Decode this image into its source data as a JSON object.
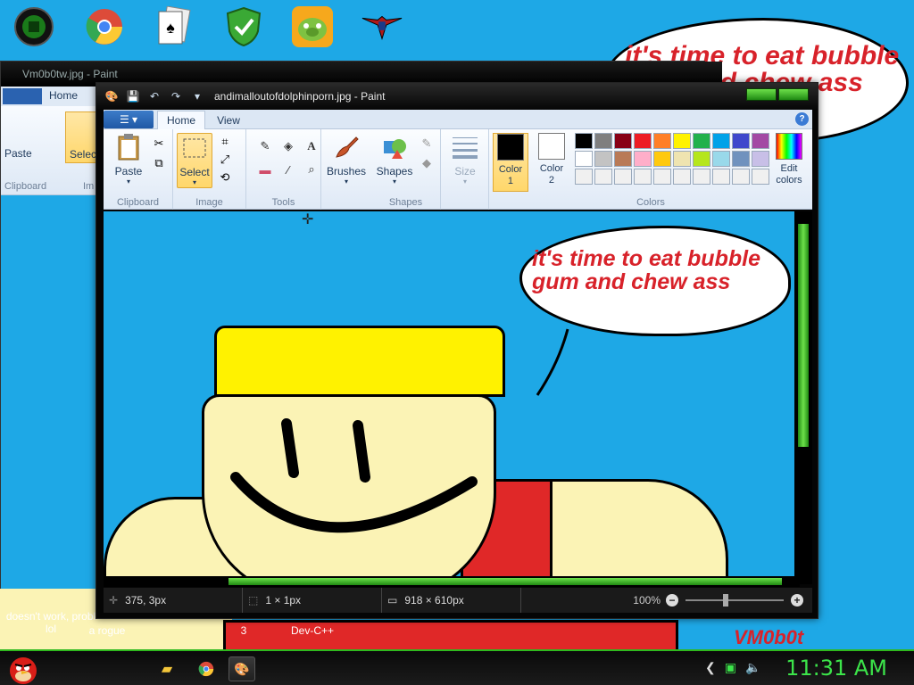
{
  "desktop": {
    "icons": [
      {
        "name": "desktop-app-icon-1",
        "icon": "green-circle-icon"
      },
      {
        "name": "chrome-icon",
        "icon": "chrome-icon"
      },
      {
        "name": "solitaire-icon",
        "icon": "cards-icon"
      },
      {
        "name": "security-shield-icon",
        "icon": "shield-icon"
      },
      {
        "name": "angry-birds-pig-icon",
        "icon": "pig-icon"
      },
      {
        "name": "emblem-icon",
        "icon": "winged-emblem-icon"
      }
    ],
    "labels": {
      "doesnt_work": "doesn't work, probl",
      "lol": "lol",
      "rogue": "a rogue",
      "three": "3",
      "devcpp": "Dev-C++"
    },
    "bubble_text": "it's time to eat bubble gum and chew ass",
    "watermark": "VM0b0t"
  },
  "back_window": {
    "title": "Vm0b0tw.jpg - Paint",
    "tab_home": "Home",
    "paste": "Paste",
    "select": "Selec",
    "clipboard": "Clipboard",
    "image": "Im"
  },
  "window": {
    "title": "andimalloutofdolphinporn.jpg - Paint",
    "tabs": {
      "home": "Home",
      "view": "View"
    },
    "ribbon": {
      "paste": "Paste",
      "clipboard": "Clipboard",
      "select": "Select",
      "image": "Image",
      "tools": "Tools",
      "brushes": "Brushes",
      "shapes_btn": "Shapes",
      "shapes_group": "Shapes",
      "size": "Size",
      "color1": "Color\n1",
      "color2": "Color\n2",
      "edit_colors": "Edit\ncolors",
      "colors": "Colors"
    },
    "palette": [
      "#000000",
      "#7f7f7f",
      "#880015",
      "#ed1c24",
      "#ff7f27",
      "#fff200",
      "#22b14c",
      "#00a2e8",
      "#3f48cc",
      "#a349a4",
      "#ffffff",
      "#c3c3c3",
      "#b97a57",
      "#ffaec9",
      "#ffc90e",
      "#efe4b0",
      "#b5e61d",
      "#99d9ea",
      "#7092be",
      "#c8bfe7",
      "#f0f0f0",
      "#f0f0f0",
      "#f0f0f0",
      "#f0f0f0",
      "#f0f0f0",
      "#f0f0f0",
      "#f0f0f0",
      "#f0f0f0",
      "#f0f0f0",
      "#f0f0f0"
    ],
    "canvas_text": "it's time to eat bubble gum and chew ass",
    "status": {
      "position": "375, 3px",
      "selection": "1 × 1px",
      "size": "918 × 610px",
      "zoom": "100%"
    }
  },
  "taskbar": {
    "clock": "11:31 AM",
    "items": [
      "folder-icon",
      "chrome-icon",
      "paint-icon"
    ]
  },
  "colors": {
    "desktop_bg": "#1ea8e6",
    "accent_green": "#3ce44a",
    "bubble_red": "#d8222a"
  }
}
